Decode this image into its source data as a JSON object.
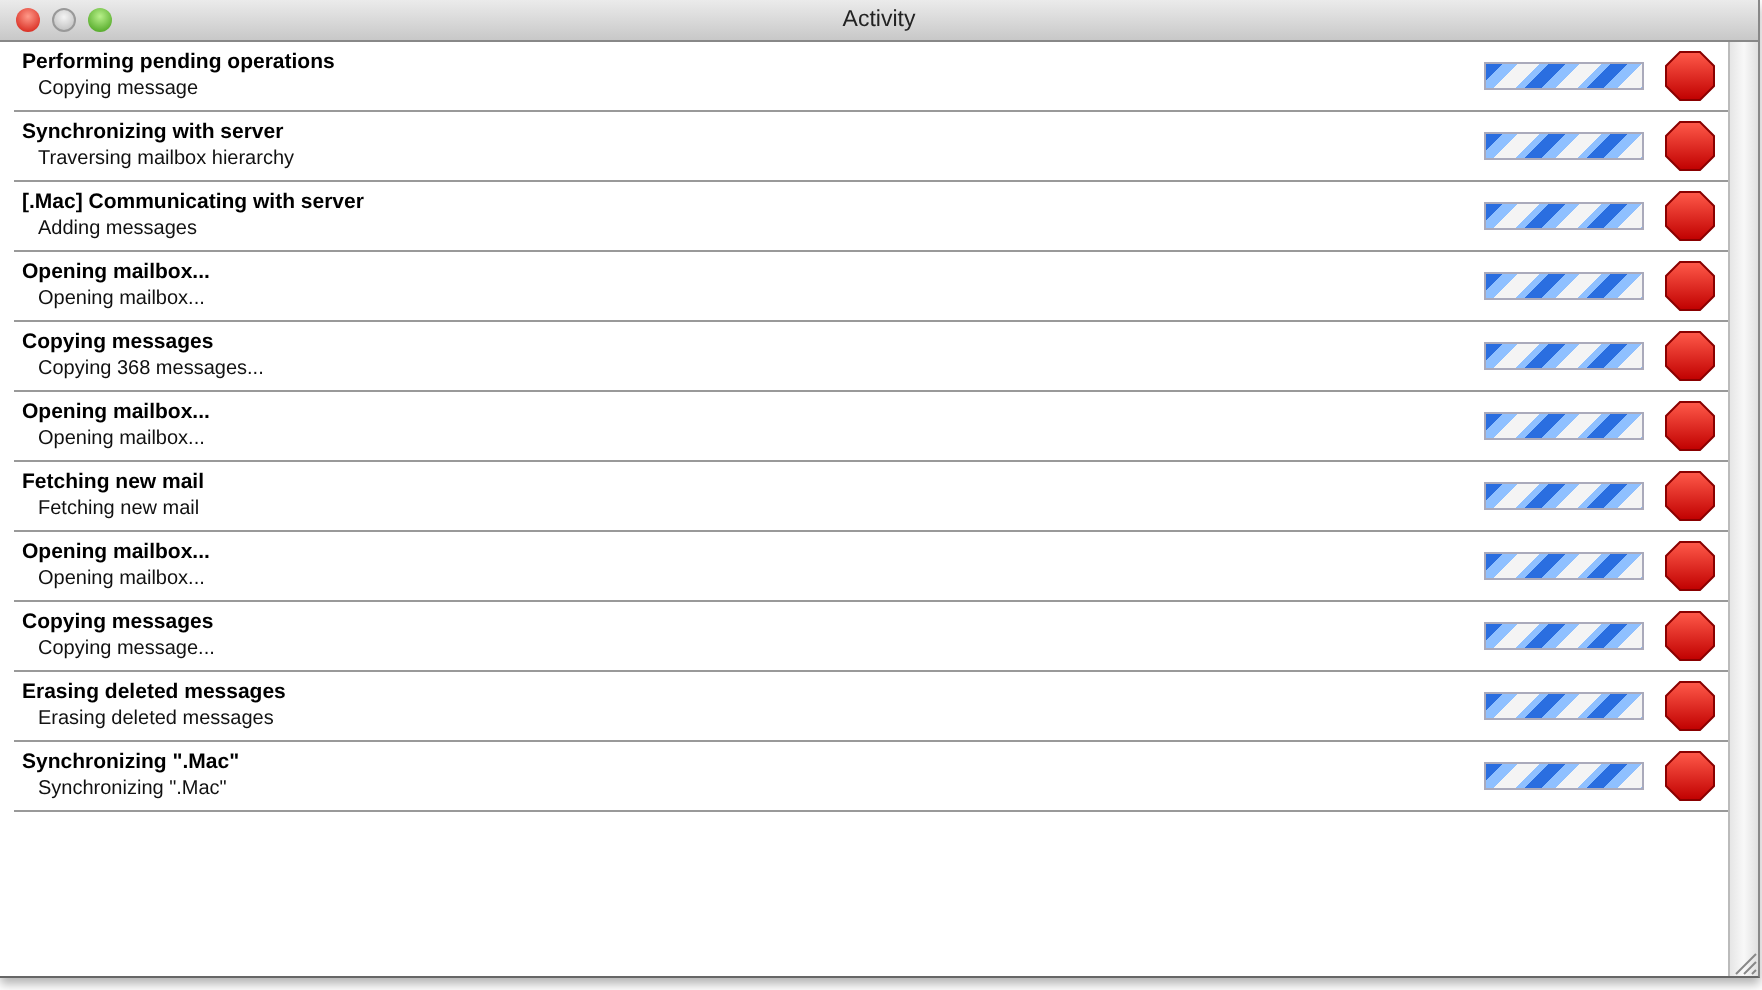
{
  "window": {
    "title": "Activity"
  },
  "tasks": [
    {
      "title": "Performing pending operations",
      "status": "Copying message",
      "indeterminate": true
    },
    {
      "title": "Synchronizing with server",
      "status": "Traversing mailbox hierarchy",
      "indeterminate": true
    },
    {
      "title": "[.Mac] Communicating with server",
      "status": "Adding messages",
      "indeterminate": true
    },
    {
      "title": "Opening mailbox...",
      "status": "Opening mailbox...",
      "indeterminate": true
    },
    {
      "title": "Copying messages",
      "status": "Copying 368 messages...",
      "indeterminate": true
    },
    {
      "title": "Opening mailbox...",
      "status": "Opening mailbox...",
      "indeterminate": true
    },
    {
      "title": "Fetching new mail",
      "status": "Fetching new mail",
      "indeterminate": true
    },
    {
      "title": "Opening mailbox...",
      "status": "Opening mailbox...",
      "indeterminate": true
    },
    {
      "title": "Copying messages",
      "status": "Copying message...",
      "indeterminate": true
    },
    {
      "title": "Erasing deleted messages",
      "status": "Erasing deleted messages",
      "indeterminate": true
    },
    {
      "title": "Synchronizing \".Mac\"",
      "status": "Synchronizing \".Mac\"",
      "indeterminate": true
    }
  ]
}
